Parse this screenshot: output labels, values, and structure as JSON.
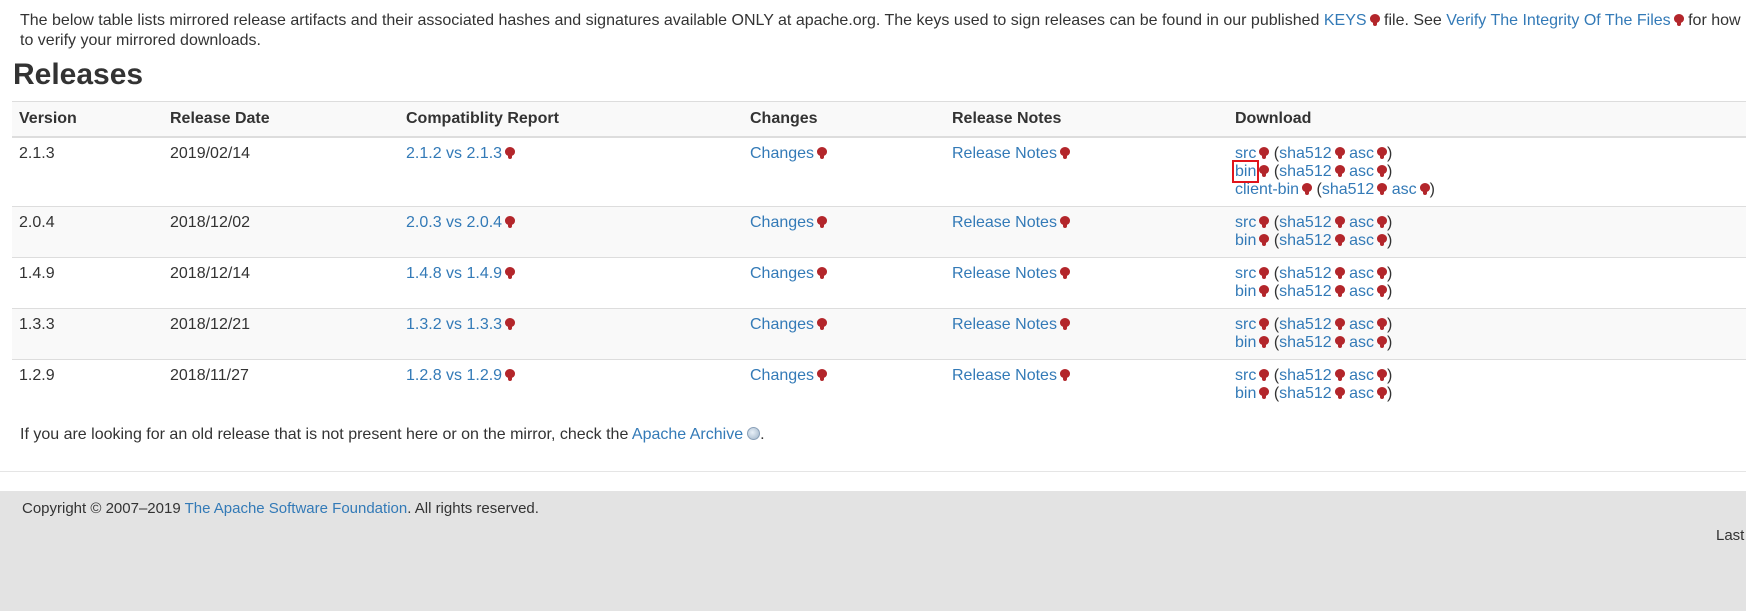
{
  "intro": {
    "text_1": "The below table lists mirrored release artifacts and their associated hashes and signatures available ONLY at apache.org. The keys used to sign releases can be found in our published ",
    "keys_link": "KEYS",
    "text_2": " file. See ",
    "verify_link": "Verify The Integrity Of The Files",
    "text_3": " for how to verify your mirrored downloads."
  },
  "page_title": "Releases",
  "table": {
    "headers": [
      "Version",
      "Release Date",
      "Compatiblity Report",
      "Changes",
      "Release Notes",
      "Download"
    ],
    "rows": [
      {
        "version": "2.1.3",
        "date": "2019/02/14",
        "compat": "2.1.2 vs 2.1.3",
        "changes": "Changes",
        "notes": "Release Notes",
        "downloads": [
          {
            "name": "src",
            "sha": "sha512",
            "asc": "asc"
          },
          {
            "name": "bin",
            "sha": "sha512",
            "asc": "asc"
          },
          {
            "name": "client-bin",
            "sha": "sha512",
            "asc": "asc"
          }
        ]
      },
      {
        "version": "2.0.4",
        "date": "2018/12/02",
        "compat": "2.0.3 vs 2.0.4",
        "changes": "Changes",
        "notes": "Release Notes",
        "downloads": [
          {
            "name": "src",
            "sha": "sha512",
            "asc": "asc"
          },
          {
            "name": "bin",
            "sha": "sha512",
            "asc": "asc"
          }
        ]
      },
      {
        "version": "1.4.9",
        "date": "2018/12/14",
        "compat": "1.4.8 vs 1.4.9",
        "changes": "Changes",
        "notes": "Release Notes",
        "downloads": [
          {
            "name": "src",
            "sha": "sha512",
            "asc": "asc"
          },
          {
            "name": "bin",
            "sha": "sha512",
            "asc": "asc"
          }
        ]
      },
      {
        "version": "1.3.3",
        "date": "2018/12/21",
        "compat": "1.3.2 vs 1.3.3",
        "changes": "Changes",
        "notes": "Release Notes",
        "downloads": [
          {
            "name": "src",
            "sha": "sha512",
            "asc": "asc"
          },
          {
            "name": "bin",
            "sha": "sha512",
            "asc": "asc"
          }
        ]
      },
      {
        "version": "1.2.9",
        "date": "2018/11/27",
        "compat": "1.2.8 vs 1.2.9",
        "changes": "Changes",
        "notes": "Release Notes",
        "downloads": [
          {
            "name": "src",
            "sha": "sha512",
            "asc": "asc"
          },
          {
            "name": "bin",
            "sha": "sha512",
            "asc": "asc"
          }
        ]
      }
    ]
  },
  "archive": {
    "text": "If you are looking for an old release that is not present here or on the mirror, check the ",
    "link": "Apache Archive",
    "end": "."
  },
  "footer": {
    "copyright_text": "Copyright © 2007–2019 ",
    "asf_link": "The Apache Software Foundation",
    "rights": ". All rights reserved.",
    "last_published": "Last Pub"
  },
  "colors": {
    "link": "#337ab7",
    "external_icon": "#b3262b",
    "highlight": "#e0141b",
    "footer_bg": "#e3e3e3"
  },
  "icons": {
    "external": "external-link-icon",
    "globe": "globe-icon"
  }
}
